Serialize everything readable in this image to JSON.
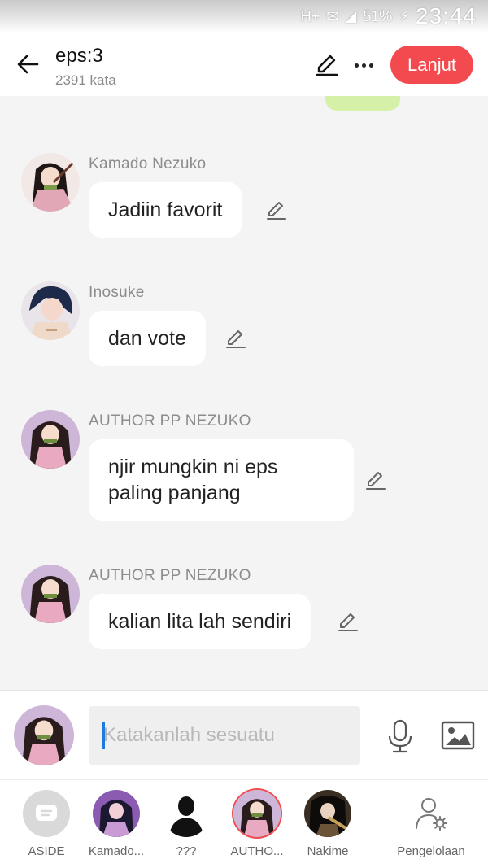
{
  "status_bar": {
    "network": "H+",
    "battery": "51%",
    "time": "23:44"
  },
  "header": {
    "title": "eps:3",
    "subtitle": "2391 kata",
    "next_label": "Lanjut"
  },
  "messages": [
    {
      "sender": "Kamado Nezuko",
      "text": "Jadiin favorit"
    },
    {
      "sender": "Inosuke",
      "text": "dan vote"
    },
    {
      "sender": "AUTHOR PP NEZUKO",
      "text": "njir mungkin ni eps paling panjang"
    },
    {
      "sender": "AUTHOR PP NEZUKO",
      "text": "kalian lita lah sendiri"
    }
  ],
  "composer": {
    "placeholder": "Katakanlah sesuatu"
  },
  "character_bar": {
    "items": [
      {
        "label": "ASIDE"
      },
      {
        "label": "Kamado..."
      },
      {
        "label": "???"
      },
      {
        "label": "AUTHO..."
      },
      {
        "label": "Nakime"
      },
      {
        "label": "Pengelolaan"
      }
    ],
    "selected": "AUTHO..."
  },
  "colors": {
    "accent": "#f24a4e",
    "bubble": "#ffffff",
    "own_bubble": "#d4f1a7",
    "background": "#f4f4f4"
  }
}
